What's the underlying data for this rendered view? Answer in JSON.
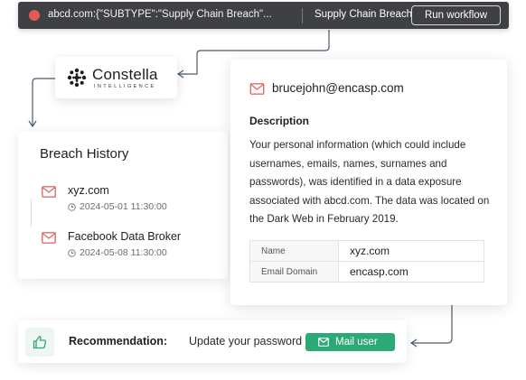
{
  "topbar": {
    "query": "abcd.com:{\"SUBTYPE\":\"Supply Chain Breach\"...",
    "subtype": "Supply Chain Breach",
    "run_button": "Run workflow"
  },
  "logo": {
    "brand": "Constella",
    "tagline": "INTELLIGENCE"
  },
  "history": {
    "title": "Breach History",
    "items": [
      {
        "name": "xyz.com",
        "time": "2024-05-01 11:30:00"
      },
      {
        "name": "Facebook Data Broker",
        "time": "2024-05-08 11:30:00"
      }
    ]
  },
  "detail": {
    "email": "brucejohn@encasp.com",
    "description_title": "Description",
    "description": "Your personal information (which could include usernames, emails, names, surnames and passwords), was identified in a data exposure associated with abcd.com. The data was located on the Dark Web in February 2019.",
    "table": [
      {
        "key": "Name",
        "value": "xyz.com"
      },
      {
        "key": "Email Domain",
        "value": "encasp.com"
      }
    ]
  },
  "recommendation": {
    "label": "Recommendation:",
    "text": "Update your password",
    "button": "Mail user"
  },
  "colors": {
    "topbar_bg": "#3f4043",
    "status_dot": "#e35a5a",
    "accent_green": "#2ba977",
    "mail_icon": "#e06b6b",
    "connector": "#4a5a6a"
  },
  "icons": [
    "status-dot",
    "constella-logo",
    "mail-icon",
    "clock-icon",
    "thumbs-up-icon",
    "arrow-icon"
  ]
}
